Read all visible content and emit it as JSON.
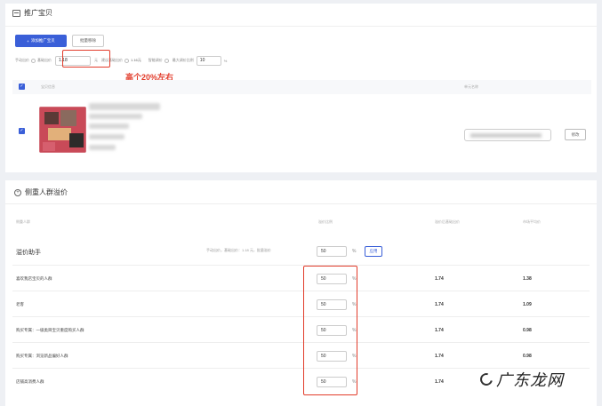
{
  "promo": {
    "title": "推广宝贝",
    "add_button": "添加推广宝贝",
    "remove_button": "批量移除",
    "bid_label": "手动出价",
    "bid_sub_label": "基础出价",
    "bid_value": "1.18",
    "bid_suffix": "元",
    "suggested_label": "建议基础出价",
    "suggested_value": "1.16元",
    "smart_label": "智能调价",
    "max_ratio_label": "最大调价比例",
    "max_ratio_value": "10",
    "max_ratio_unit": "%",
    "annotation": "高个20%左右",
    "col_item": "宝贝信息",
    "col_unit": "单元名称",
    "modify_button": "修改"
  },
  "crowd": {
    "title": "侧重人群溢价",
    "col_crowd": "侧重人群",
    "col_premium": "溢价比例",
    "col_suggested": "溢价后基础出价",
    "col_avg": "市场平均价",
    "helper_title": "溢价助手",
    "helper_text": "手动出价，基础出价：1.18 元，批量溢价",
    "helper_value": "50",
    "pct": "%",
    "apply_button": "应用",
    "rows": [
      {
        "name": "喜欢我店宝贝的人群",
        "premium": "50",
        "suggested": "1.74",
        "avg": "1.38"
      },
      {
        "name": "老客",
        "premium": "50",
        "suggested": "1.74",
        "avg": "1.09"
      },
      {
        "name": "购买专属：一级类目宝贝重度购买人群",
        "premium": "50",
        "suggested": "1.74",
        "avg": "0.98"
      },
      {
        "name": "购买专属：浏览新品偏好人群",
        "premium": "50",
        "suggested": "1.74",
        "avg": "0.98"
      },
      {
        "name": "店铺高消费人群",
        "premium": "50",
        "suggested": "1.74",
        "avg": ""
      }
    ]
  },
  "watermark": "广东龙网",
  "colors": {
    "primary": "#3a5fd8",
    "annotation_red": "#e23c2b"
  }
}
